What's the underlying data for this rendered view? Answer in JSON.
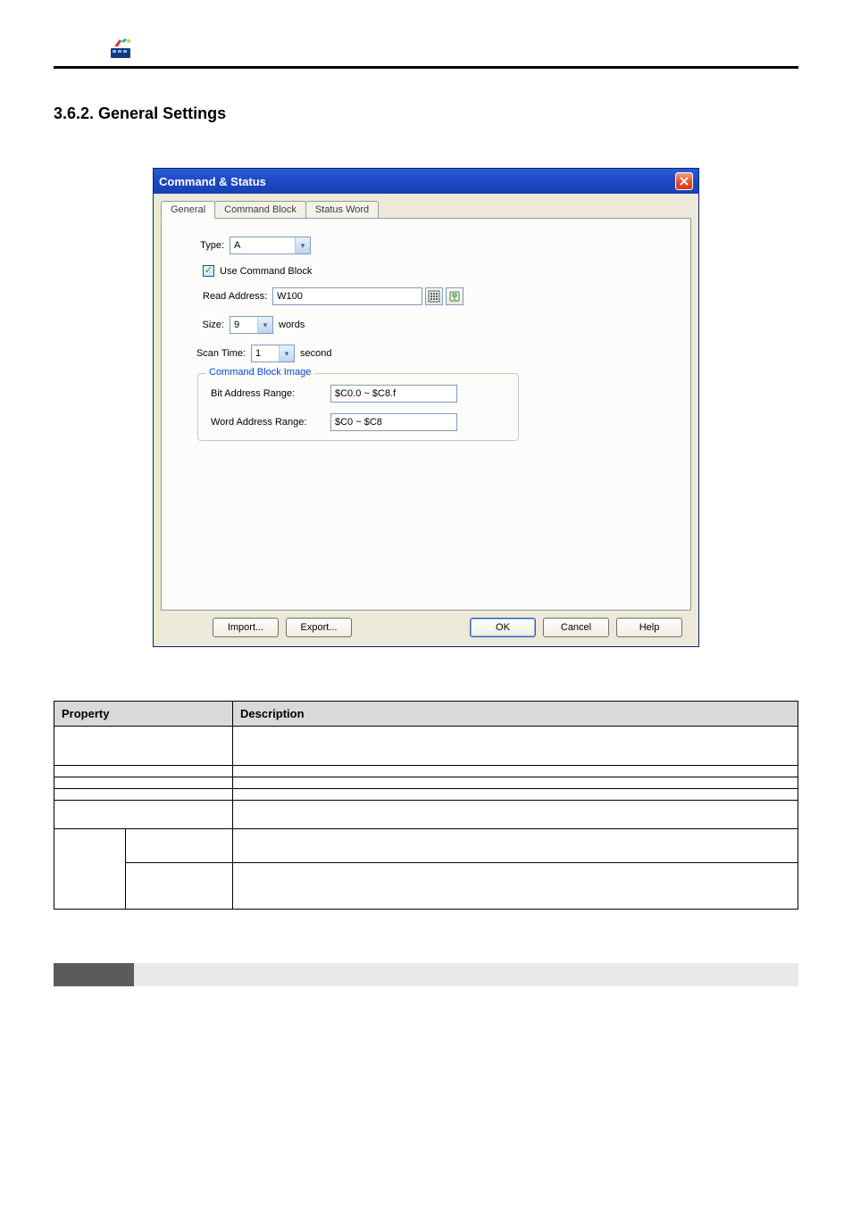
{
  "heading": "3.6.2. General Settings",
  "dialog": {
    "title": "Command & Status",
    "tabs": {
      "general": "General",
      "command_block": "Command Block",
      "status_word": "Status Word"
    },
    "labels": {
      "type": "Type:",
      "use_command_block": "Use Command Block",
      "read_address": "Read Address:",
      "size": "Size:",
      "size_unit": "words",
      "scan_time": "Scan Time:",
      "scan_unit": "second",
      "legend": "Command Block Image",
      "bit_range": "Bit Address Range:",
      "word_range": "Word Address Range:"
    },
    "values": {
      "type": "A",
      "read_address": "W100",
      "size": "9",
      "scan_time": "1",
      "bit_range": "$C0.0 ~ $C8.f",
      "word_range": "$C0 ~ $C8"
    },
    "buttons": {
      "import": "Import...",
      "export": "Export...",
      "ok": "OK",
      "cancel": "Cancel",
      "help": "Help"
    }
  },
  "table": {
    "headers": {
      "property": "Property",
      "description": "Description"
    },
    "rows": [
      {
        "property": "",
        "description": "",
        "colspan_property": 2
      },
      {
        "property": "",
        "description": "",
        "colspan_property": 2
      },
      {
        "property": "",
        "description": "",
        "colspan_property": 2
      },
      {
        "property": "",
        "description": "",
        "colspan_property": 2
      },
      {
        "property": "",
        "description": "",
        "colspan_property": 2
      }
    ],
    "grouped": {
      "group_label": "",
      "items": [
        {
          "property": "",
          "description": ""
        },
        {
          "property": "",
          "description": ""
        }
      ]
    }
  }
}
